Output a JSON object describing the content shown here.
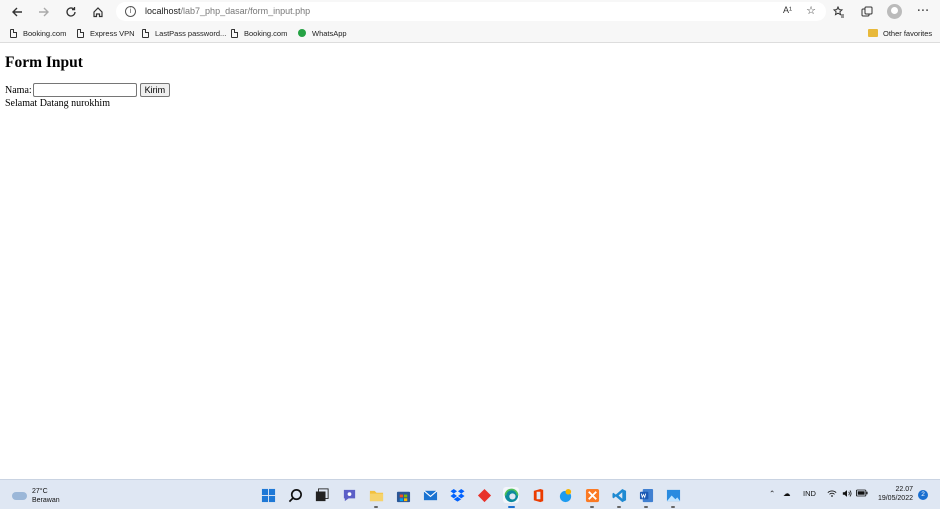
{
  "browser": {
    "url_host": "localhost",
    "url_path": "/lab7_php_dasar/form_input.php",
    "read_aloud_label": "A¹"
  },
  "bookmarks": [
    {
      "label": "Booking.com",
      "icon": "page-icon"
    },
    {
      "label": "Express VPN",
      "icon": "page-icon"
    },
    {
      "label": "LastPass password...",
      "icon": "page-icon"
    },
    {
      "label": "Booking.com",
      "icon": "page-icon"
    },
    {
      "label": "WhatsApp",
      "icon": "whatsapp-icon"
    }
  ],
  "other_favorites": "Other favorites",
  "page": {
    "heading": "Form Input",
    "name_label": "Nama:",
    "name_value": "",
    "submit_label": "Kirim",
    "greeting": "Selamat Datang nurokhim"
  },
  "taskbar": {
    "weather_temp": "27°C",
    "weather_desc": "Berawan",
    "language": "IND",
    "time": "22.07",
    "date": "19/05/2022",
    "notification_count": "2"
  },
  "colors": {
    "accent": "#1a6fd0",
    "taskbar_bg": "#dfe7f3",
    "toolbar_bg": "#f7f7f7"
  }
}
